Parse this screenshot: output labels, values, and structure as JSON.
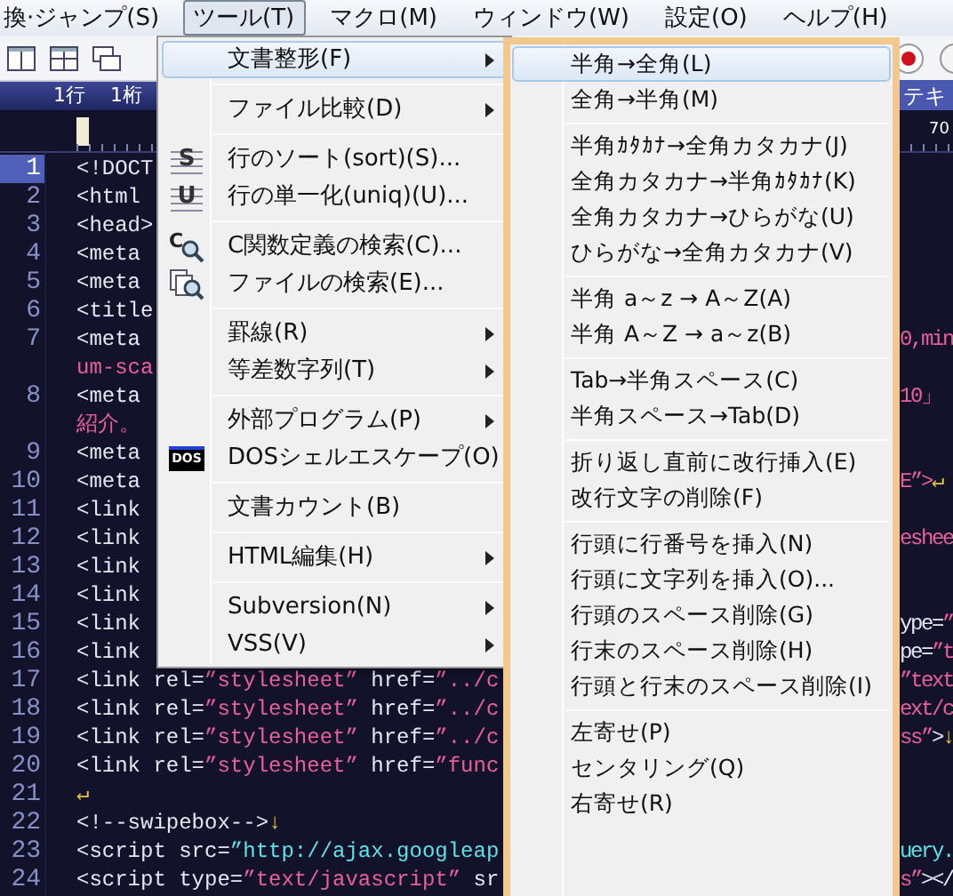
{
  "menubar": [
    {
      "label": "換·ジャンプ(S)",
      "selected": false
    },
    {
      "label": "ツール(T)",
      "selected": true
    },
    {
      "label": "マクロ(M)",
      "selected": false
    },
    {
      "label": "ウィンドウ(W)",
      "selected": false
    },
    {
      "label": "設定(O)",
      "selected": false
    },
    {
      "label": "ヘルプ(H)",
      "selected": false
    }
  ],
  "status": {
    "line": "1行",
    "column": "1桁",
    "tab_label": "テキ"
  },
  "ruler": {
    "mark": "70"
  },
  "code_lines": [
    {
      "number": "1",
      "current": true,
      "left": [
        {
          "kind": "tag",
          "text": "<!DOCT"
        }
      ]
    },
    {
      "number": "2",
      "current": false,
      "left": [
        {
          "kind": "tag",
          "text": "<html"
        }
      ]
    },
    {
      "number": "3",
      "current": false,
      "left": [
        {
          "kind": "tag",
          "text": "<head>"
        }
      ]
    },
    {
      "number": "4",
      "current": false,
      "left": [
        {
          "kind": "tag",
          "text": "<meta"
        }
      ]
    },
    {
      "number": "5",
      "current": false,
      "left": [
        {
          "kind": "tag",
          "text": "<meta"
        }
      ]
    },
    {
      "number": "6",
      "current": false,
      "left": [
        {
          "kind": "tag",
          "text": "<title"
        }
      ]
    },
    {
      "number": "7",
      "current": false,
      "left": [
        {
          "kind": "tag",
          "text": "<meta"
        }
      ],
      "right": [
        {
          "kind": "string",
          "text": "0,min"
        }
      ]
    },
    {
      "left": [
        {
          "kind": "string",
          "text": "um-sca"
        }
      ]
    },
    {
      "number": "8",
      "current": false,
      "left": [
        {
          "kind": "tag",
          "text": "<meta"
        }
      ],
      "right": [
        {
          "kind": "string",
          "text": "10」"
        }
      ]
    },
    {
      "left": [
        {
          "kind": "string",
          "text": "紹介。"
        }
      ]
    },
    {
      "number": "9",
      "current": false,
      "left": [
        {
          "kind": "tag",
          "text": "<meta"
        }
      ]
    },
    {
      "number": "10",
      "current": false,
      "left": [
        {
          "kind": "tag",
          "text": "<meta"
        }
      ],
      "right": [
        {
          "kind": "string",
          "text": "E”>"
        },
        {
          "kind": "mark",
          "text": "↵"
        }
      ]
    },
    {
      "number": "11",
      "current": false,
      "left": [
        {
          "kind": "tag",
          "text": "<link"
        }
      ]
    },
    {
      "number": "12",
      "current": false,
      "left": [
        {
          "kind": "tag",
          "text": "<link"
        }
      ],
      "right": [
        {
          "kind": "string",
          "text": "eshee"
        }
      ]
    },
    {
      "number": "13",
      "current": false,
      "left": [
        {
          "kind": "tag",
          "text": "<link"
        }
      ]
    },
    {
      "number": "14",
      "current": false,
      "left": [
        {
          "kind": "tag",
          "text": "<link"
        }
      ]
    },
    {
      "number": "15",
      "current": false,
      "left": [
        {
          "kind": "tag",
          "text": "<link"
        }
      ],
      "right": [
        {
          "kind": "tag",
          "text": "ype="
        },
        {
          "kind": "string",
          "text": "”"
        }
      ]
    },
    {
      "number": "16",
      "current": false,
      "left": [
        {
          "kind": "tag",
          "text": "<link"
        }
      ],
      "right": [
        {
          "kind": "tag",
          "text": "pe="
        },
        {
          "kind": "string",
          "text": "”t"
        }
      ]
    },
    {
      "number": "17",
      "current": false,
      "left": [
        {
          "kind": "tag",
          "text": "<link rel="
        },
        {
          "kind": "string",
          "text": "”stylesheet”"
        },
        {
          "kind": "tag",
          "text": " href="
        },
        {
          "kind": "string",
          "text": "”../c"
        }
      ],
      "right": [
        {
          "kind": "string",
          "text": "”text"
        }
      ]
    },
    {
      "number": "18",
      "current": false,
      "left": [
        {
          "kind": "tag",
          "text": "<link rel="
        },
        {
          "kind": "string",
          "text": "”stylesheet”"
        },
        {
          "kind": "tag",
          "text": " href="
        },
        {
          "kind": "string",
          "text": "”../c"
        }
      ],
      "right": [
        {
          "kind": "string",
          "text": "ext/c"
        }
      ]
    },
    {
      "number": "19",
      "current": false,
      "left": [
        {
          "kind": "tag",
          "text": "<link rel="
        },
        {
          "kind": "string",
          "text": "”stylesheet”"
        },
        {
          "kind": "tag",
          "text": " href="
        },
        {
          "kind": "string",
          "text": "”../c"
        }
      ],
      "right": [
        {
          "kind": "string",
          "text": "ss”"
        },
        {
          "kind": "tag",
          "text": ">"
        },
        {
          "kind": "mark",
          "text": "↓"
        }
      ]
    },
    {
      "number": "20",
      "current": false,
      "left": [
        {
          "kind": "tag",
          "text": "<link rel="
        },
        {
          "kind": "string",
          "text": "”stylesheet”"
        },
        {
          "kind": "tag",
          "text": " href="
        },
        {
          "kind": "string",
          "text": "”func"
        }
      ]
    },
    {
      "number": "21",
      "current": false,
      "left": [
        {
          "kind": "mark",
          "text": "↵"
        }
      ]
    },
    {
      "number": "22",
      "current": false,
      "left": [
        {
          "kind": "tag",
          "text": "<!--swipebox-->"
        },
        {
          "kind": "mark",
          "text": "↓"
        }
      ]
    },
    {
      "number": "23",
      "current": false,
      "left": [
        {
          "kind": "tag",
          "text": "<script src="
        },
        {
          "kind": "url",
          "text": "”http://ajax.googleap"
        }
      ],
      "right": [
        {
          "kind": "url",
          "text": "uery."
        }
      ]
    },
    {
      "number": "24",
      "current": false,
      "left": [
        {
          "kind": "tag",
          "text": "<script type="
        },
        {
          "kind": "string",
          "text": "”text/javascript”"
        },
        {
          "kind": "tag",
          "text": " sr"
        }
      ],
      "right": [
        {
          "kind": "string",
          "text": "s”"
        },
        {
          "kind": "tag",
          "text": "></"
        }
      ]
    }
  ],
  "tools_menu": [
    {
      "kind": "item",
      "label": "文書整形(F)",
      "submenu": true,
      "selected": true
    },
    {
      "kind": "separator"
    },
    {
      "kind": "item",
      "label": "ファイル比較(D)",
      "submenu": true,
      "selected": false
    },
    {
      "kind": "separator"
    },
    {
      "kind": "item",
      "label": "行のソート(sort)(S)...",
      "submenu": false,
      "selected": false,
      "icon": {
        "kind": "letter",
        "text": "S"
      }
    },
    {
      "kind": "item",
      "label": "行の単一化(uniq)(U)...",
      "submenu": false,
      "selected": false,
      "icon": {
        "kind": "letter",
        "text": "U"
      }
    },
    {
      "kind": "separator"
    },
    {
      "kind": "item",
      "label": "C関数定義の検索(C)...",
      "submenu": false,
      "selected": false,
      "icon": {
        "kind": "search",
        "text": "C"
      }
    },
    {
      "kind": "item",
      "label": "ファイルの検索(E)...",
      "submenu": false,
      "selected": false,
      "icon": {
        "kind": "files"
      }
    },
    {
      "kind": "separator"
    },
    {
      "kind": "item",
      "label": "罫線(R)",
      "submenu": true,
      "selected": false
    },
    {
      "kind": "item",
      "label": "等差数字列(T)",
      "submenu": true,
      "selected": false
    },
    {
      "kind": "separator"
    },
    {
      "kind": "item",
      "label": "外部プログラム(P)",
      "submenu": true,
      "selected": false
    },
    {
      "kind": "item",
      "label": "DOSシェルエスケープ(O)",
      "submenu": false,
      "selected": false,
      "icon": {
        "kind": "badge",
        "text": "DOS"
      }
    },
    {
      "kind": "separator"
    },
    {
      "kind": "item",
      "label": "文書カウント(B)",
      "submenu": false,
      "selected": false
    },
    {
      "kind": "separator"
    },
    {
      "kind": "item",
      "label": "HTML編集(H)",
      "submenu": true,
      "selected": false
    },
    {
      "kind": "separator"
    },
    {
      "kind": "item",
      "label": "Subversion(N)",
      "submenu": true,
      "selected": false
    },
    {
      "kind": "item",
      "label": "VSS(V)",
      "submenu": true,
      "selected": false
    }
  ],
  "format_submenu": [
    {
      "kind": "item",
      "label": "半角→全角(L)",
      "selected": true
    },
    {
      "kind": "item",
      "label": "全角→半角(M)",
      "selected": false
    },
    {
      "kind": "separator"
    },
    {
      "kind": "item",
      "label": "半角ｶﾀｶﾅ→全角カタカナ(J)",
      "selected": false
    },
    {
      "kind": "item",
      "label": "全角カタカナ→半角ｶﾀｶﾅ(K)",
      "selected": false
    },
    {
      "kind": "item",
      "label": "全角カタカナ→ひらがな(U)",
      "selected": false
    },
    {
      "kind": "item",
      "label": "ひらがな→全角カタカナ(V)",
      "selected": false
    },
    {
      "kind": "separator"
    },
    {
      "kind": "item",
      "label": "半角 a～z → A～Z(A)",
      "selected": false
    },
    {
      "kind": "item",
      "label": "半角 A～Z → a～z(B)",
      "selected": false
    },
    {
      "kind": "separator"
    },
    {
      "kind": "item",
      "label": "Tab→半角スペース(C)",
      "selected": false
    },
    {
      "kind": "item",
      "label": "半角スペース→Tab(D)",
      "selected": false
    },
    {
      "kind": "separator"
    },
    {
      "kind": "item",
      "label": "折り返し直前に改行挿入(E)",
      "selected": false
    },
    {
      "kind": "item",
      "label": "改行文字の削除(F)",
      "selected": false
    },
    {
      "kind": "separator"
    },
    {
      "kind": "item",
      "label": "行頭に行番号を挿入(N)",
      "selected": false
    },
    {
      "kind": "item",
      "label": "行頭に文字列を挿入(O)...",
      "selected": false
    },
    {
      "kind": "item",
      "label": "行頭のスペース削除(G)",
      "selected": false
    },
    {
      "kind": "item",
      "label": "行末のスペース削除(H)",
      "selected": false
    },
    {
      "kind": "item",
      "label": "行頭と行末のスペース削除(I)",
      "selected": false
    },
    {
      "kind": "separator"
    },
    {
      "kind": "item",
      "label": "左寄せ(P)",
      "selected": false
    },
    {
      "kind": "item",
      "label": "センタリング(Q)",
      "selected": false
    },
    {
      "kind": "item",
      "label": "右寄せ(R)",
      "selected": false
    }
  ]
}
